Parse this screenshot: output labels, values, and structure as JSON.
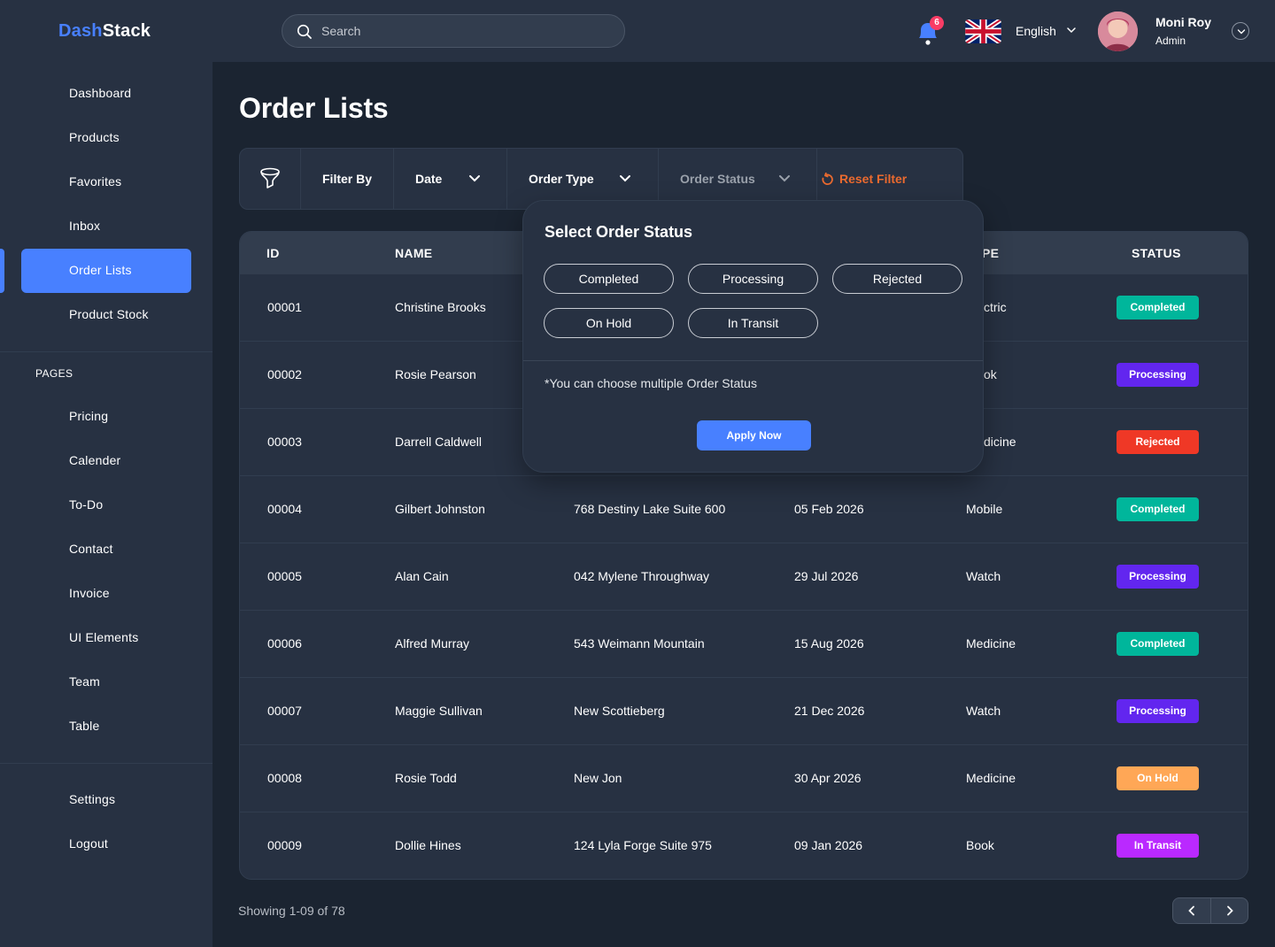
{
  "brand": {
    "part1": "Dash",
    "part2": "Stack"
  },
  "search": {
    "placeholder": "Search"
  },
  "header": {
    "notification_count": "6",
    "language": "English",
    "user_name": "Moni Roy",
    "user_role": "Admin"
  },
  "sidebar": {
    "main_items": [
      {
        "label": "Dashboard"
      },
      {
        "label": "Products"
      },
      {
        "label": "Favorites"
      },
      {
        "label": "Inbox"
      },
      {
        "label": "Order Lists"
      },
      {
        "label": "Product Stock"
      }
    ],
    "pages_label": "PAGES",
    "page_items": [
      {
        "label": "Pricing"
      },
      {
        "label": "Calender"
      },
      {
        "label": "To-Do"
      },
      {
        "label": "Contact"
      },
      {
        "label": "Invoice"
      },
      {
        "label": "UI Elements"
      },
      {
        "label": "Team"
      },
      {
        "label": "Table"
      }
    ],
    "bottom_items": [
      {
        "label": "Settings"
      },
      {
        "label": "Logout"
      }
    ],
    "active_item": "Order Lists"
  },
  "page": {
    "title": "Order Lists"
  },
  "filters": {
    "filter_by": "Filter By",
    "date": "Date",
    "order_type": "Order Type",
    "order_status": "Order Status",
    "reset": "Reset Filter"
  },
  "table": {
    "headers": {
      "id": "ID",
      "name": "NAME",
      "type": "PE",
      "status": "STATUS"
    },
    "rows": [
      {
        "id": "00001",
        "name": "Christine Brooks",
        "address": "",
        "date": "",
        "type": "ctric",
        "status": "Completed"
      },
      {
        "id": "00002",
        "name": "Rosie Pearson",
        "address": "",
        "date": "",
        "type": "ok",
        "status": "Processing"
      },
      {
        "id": "00003",
        "name": "Darrell Caldwell",
        "address": "",
        "date": "",
        "type": "dicine",
        "status": "Rejected"
      },
      {
        "id": "00004",
        "name": "Gilbert Johnston",
        "address": "768 Destiny Lake Suite 600",
        "date": "05 Feb 2026",
        "type": "Mobile",
        "status": "Completed"
      },
      {
        "id": "00005",
        "name": "Alan Cain",
        "address": "042 Mylene Throughway",
        "date": "29 Jul 2026",
        "type": "Watch",
        "status": "Processing"
      },
      {
        "id": "00006",
        "name": "Alfred Murray",
        "address": "543 Weimann Mountain",
        "date": "15 Aug 2026",
        "type": "Medicine",
        "status": "Completed"
      },
      {
        "id": "00007",
        "name": "Maggie Sullivan",
        "address": "New Scottieberg",
        "date": "21 Dec 2026",
        "type": "Watch",
        "status": "Processing"
      },
      {
        "id": "00008",
        "name": "Rosie Todd",
        "address": "New Jon",
        "date": "30 Apr 2026",
        "type": "Medicine",
        "status": "On Hold"
      },
      {
        "id": "00009",
        "name": "Dollie Hines",
        "address": "124 Lyla Forge Suite 975",
        "date": "09 Jan 2026",
        "type": "Book",
        "status": "In Transit"
      }
    ]
  },
  "status_colors": {
    "Completed": "#00b69b",
    "Processing": "#6226ef",
    "Rejected": "#ef3826",
    "On Hold": "#ffa756",
    "In Transit": "#ba29ff"
  },
  "pagination": {
    "showing": "Showing 1-09 of 78"
  },
  "popup": {
    "title": "Select Order Status",
    "options": [
      "Completed",
      "Processing",
      "Rejected",
      "On Hold",
      "In Transit"
    ],
    "note": "*You can choose multiple Order Status",
    "apply": "Apply Now"
  },
  "colors": {
    "accent": "#4880ff",
    "reset": "#ea6a2f",
    "background": "#1b2431",
    "panel": "#273142"
  },
  "icons": [
    "search-icon",
    "bell-icon",
    "uk-flag-icon",
    "chevron-down-icon",
    "filter-funnel-icon",
    "reset-icon",
    "chevron-left-icon",
    "chevron-right-icon"
  ]
}
